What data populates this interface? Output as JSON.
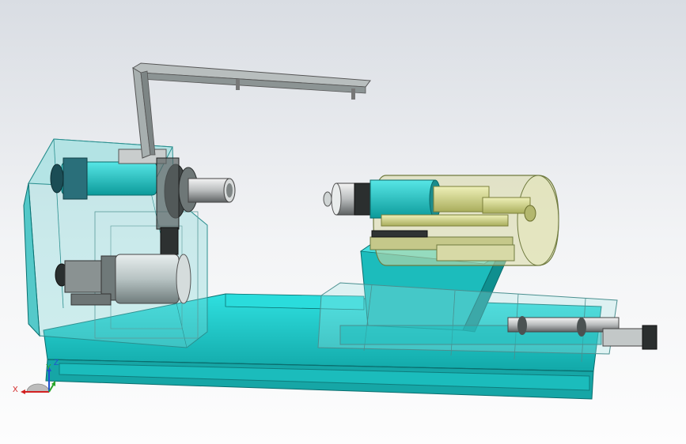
{
  "triad": {
    "x_label": "X",
    "y_label": "Y",
    "z_label": "Z",
    "x_color": "#d22020",
    "y_color": "#2aa52a",
    "z_color": "#2050d0"
  },
  "colors": {
    "base": "#1fcfcf",
    "base_dark": "#138f8f",
    "glass": "#7fd6d6",
    "carriage": "#cfd37a",
    "steel": "#9aa3a6"
  }
}
